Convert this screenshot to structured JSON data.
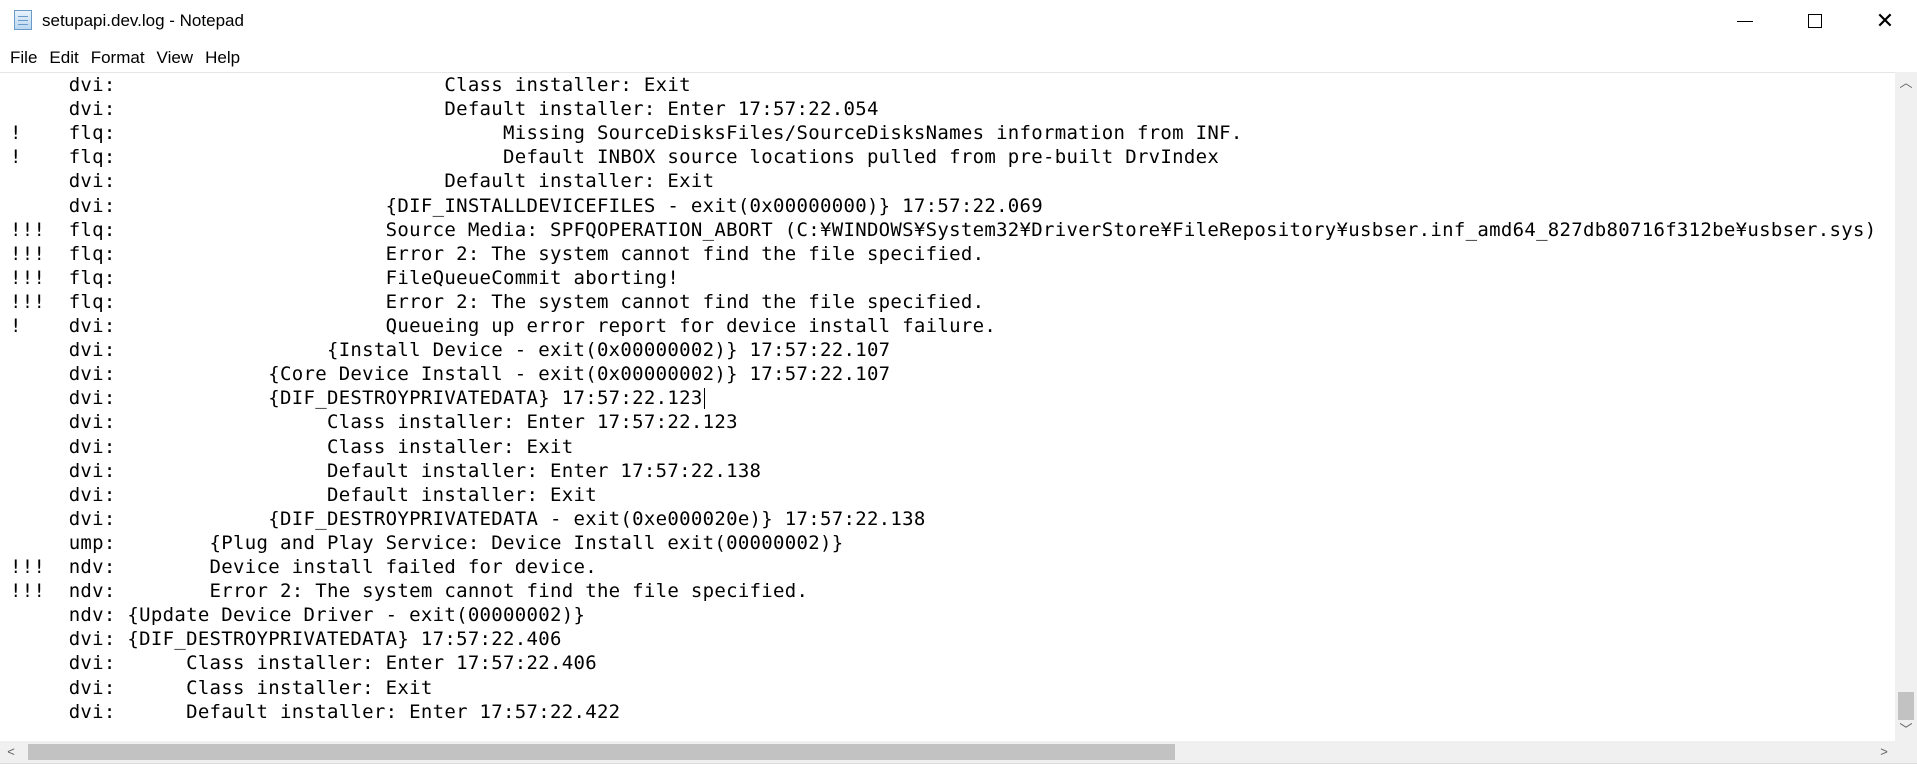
{
  "window": {
    "title": "setupapi.dev.log - Notepad",
    "icon": "notepad-icon",
    "controls": {
      "minimize": "minimize-icon",
      "maximize": "maximize-icon",
      "close": "close-icon"
    }
  },
  "menu": {
    "items": [
      "File",
      "Edit",
      "Format",
      "View",
      "Help"
    ]
  },
  "editor": {
    "lines": [
      "     dvi:                            Class installer: Exit",
      "     dvi:                            Default installer: Enter 17:57:22.054",
      "!    flq:                                 Missing SourceDisksFiles/SourceDisksNames information from INF.",
      "!    flq:                                 Default INBOX source locations pulled from pre-built DrvIndex",
      "     dvi:                            Default installer: Exit",
      "     dvi:                       {DIF_INSTALLDEVICEFILES - exit(0x00000000)} 17:57:22.069",
      "!!!  flq:                       Source Media: SPFQOPERATION_ABORT (C:¥WINDOWS¥System32¥DriverStore¥FileRepository¥usbser.inf_amd64_827db80716f312be¥usbser.sys)",
      "!!!  flq:                       Error 2: The system cannot find the file specified.",
      "!!!  flq:                       FileQueueCommit aborting!",
      "!!!  flq:                       Error 2: The system cannot find the file specified.",
      "!    dvi:                       Queueing up error report for device install failure.",
      "     dvi:                  {Install Device - exit(0x00000002)} 17:57:22.107",
      "     dvi:             {Core Device Install - exit(0x00000002)} 17:57:22.107",
      "     dvi:             {DIF_DESTROYPRIVATEDATA} 17:57:22.123",
      "     dvi:                  Class installer: Enter 17:57:22.123",
      "     dvi:                  Class installer: Exit",
      "     dvi:                  Default installer: Enter 17:57:22.138",
      "     dvi:                  Default installer: Exit",
      "     dvi:             {DIF_DESTROYPRIVATEDATA - exit(0xe000020e)} 17:57:22.138",
      "     ump:        {Plug and Play Service: Device Install exit(00000002)}",
      "!!!  ndv:        Device install failed for device.",
      "!!!  ndv:        Error 2: The system cannot find the file specified.",
      "     ndv: {Update Device Driver - exit(00000002)}",
      "     dvi: {DIF_DESTROYPRIVATEDATA} 17:57:22.406",
      "     dvi:      Class installer: Enter 17:57:22.406",
      "     dvi:      Class installer: Exit",
      "     dvi:      Default installer: Enter 17:57:22.422"
    ]
  },
  "scrollbars": {
    "vertical": {
      "up_icon": "chevron-up-icon",
      "down_icon": "chevron-down-icon"
    },
    "horizontal": {
      "left_icon": "chevron-left-icon",
      "right_icon": "chevron-right-icon"
    }
  }
}
